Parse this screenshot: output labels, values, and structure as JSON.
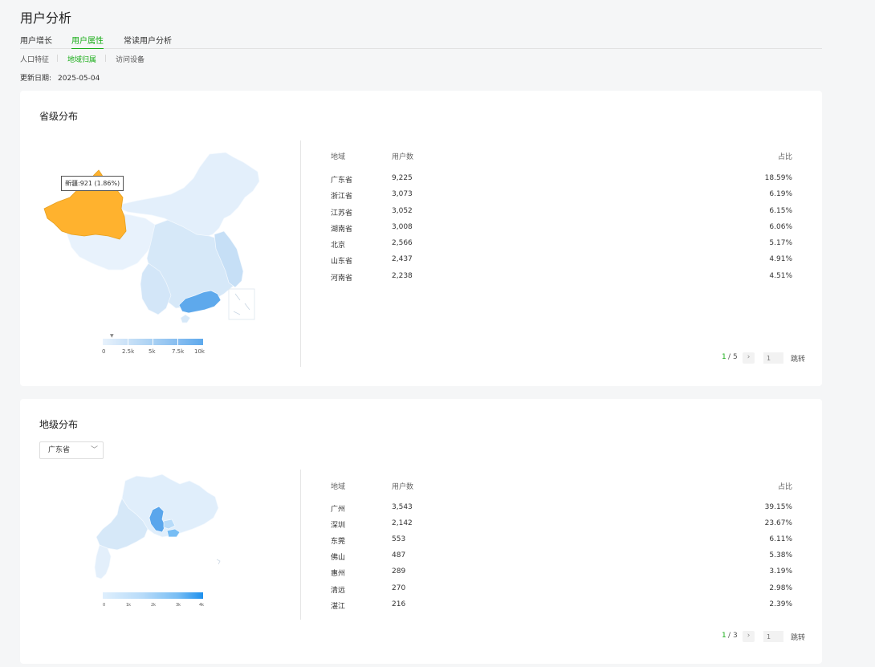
{
  "page": {
    "title": "用户分析"
  },
  "tabs": [
    {
      "label": "用户增长",
      "active": false
    },
    {
      "label": "用户属性",
      "active": true
    },
    {
      "label": "常读用户分析",
      "active": false
    }
  ],
  "subtabs": [
    {
      "label": "人口特征",
      "active": false
    },
    {
      "label": "地域归属",
      "active": true
    },
    {
      "label": "访问设备",
      "active": false
    }
  ],
  "update": {
    "label": "更新日期:",
    "value": "2025-05-04"
  },
  "province_section": {
    "title": "省级分布",
    "tooltip": "新疆:921 (1.86%)",
    "legend_labels": [
      "0",
      "2.5k",
      "5k",
      "7.5k",
      "10k"
    ],
    "table": {
      "headers": {
        "region": "地域",
        "users": "用户数",
        "share": "占比"
      },
      "rows": [
        {
          "region": "广东省",
          "users": "9,225",
          "share": "18.59%"
        },
        {
          "region": "浙江省",
          "users": "3,073",
          "share": "6.19%"
        },
        {
          "region": "江苏省",
          "users": "3,052",
          "share": "6.15%"
        },
        {
          "region": "湖南省",
          "users": "3,008",
          "share": "6.06%"
        },
        {
          "region": "北京",
          "users": "2,566",
          "share": "5.17%"
        },
        {
          "region": "山东省",
          "users": "2,437",
          "share": "4.91%"
        },
        {
          "region": "河南省",
          "users": "2,238",
          "share": "4.51%"
        }
      ]
    },
    "pager": {
      "current": "1",
      "total": "5",
      "next": "›",
      "input_placeholder": "1",
      "jump_label": "跳转"
    }
  },
  "city_section": {
    "title": "地级分布",
    "select_value": "广东省",
    "legend_labels": [
      "0",
      "1k",
      "2k",
      "3k",
      "4k"
    ],
    "table": {
      "headers": {
        "region": "地域",
        "users": "用户数",
        "share": "占比"
      },
      "rows": [
        {
          "region": "广州",
          "users": "3,543",
          "share": "39.15%"
        },
        {
          "region": "深圳",
          "users": "2,142",
          "share": "23.67%"
        },
        {
          "region": "东莞",
          "users": "553",
          "share": "6.11%"
        },
        {
          "region": "佛山",
          "users": "487",
          "share": "5.38%"
        },
        {
          "region": "惠州",
          "users": "289",
          "share": "3.19%"
        },
        {
          "region": "清远",
          "users": "270",
          "share": "2.98%"
        },
        {
          "region": "湛江",
          "users": "216",
          "share": "2.39%"
        }
      ]
    },
    "pager": {
      "current": "1",
      "total": "3",
      "next": "›",
      "input_placeholder": "1",
      "jump_label": "跳转"
    }
  },
  "colors": {
    "accent": "#1aad19",
    "highlight_region": "#ffb22e",
    "map_base": "#e3effb",
    "map_mid": "#c6dff6",
    "map_max": "#5ea9ec",
    "city_max": "#1e90ed"
  }
}
